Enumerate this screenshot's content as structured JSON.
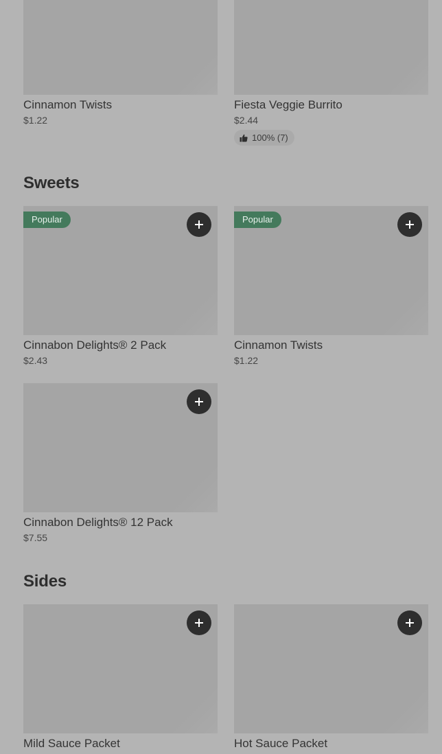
{
  "sections": {
    "top": {
      "items": [
        {
          "name": "Cinnamon Twists",
          "price": "$1.22"
        },
        {
          "name": "Fiesta Veggie Burrito",
          "price": "$2.44",
          "rating": "100% (7)"
        }
      ]
    },
    "sweets": {
      "title": "Sweets",
      "items": [
        {
          "name": "Cinnabon Delights® 2 Pack",
          "price": "$2.43",
          "badge": "Popular"
        },
        {
          "name": "Cinnamon Twists",
          "price": "$1.22",
          "badge": "Popular"
        },
        {
          "name": "Cinnabon Delights® 12 Pack",
          "price": "$7.55"
        }
      ]
    },
    "sides": {
      "title": "Sides",
      "items": [
        {
          "name": "Mild Sauce Packet"
        },
        {
          "name": "Hot Sauce Packet"
        }
      ]
    }
  },
  "colors": {
    "background": "#b4b4b4",
    "image_placeholder": "#a5a5a5",
    "popular_badge": "#447a5c",
    "add_button": "#2e2e2e"
  },
  "icons": {
    "add": "plus-icon",
    "rating": "thumbs-up-icon"
  }
}
